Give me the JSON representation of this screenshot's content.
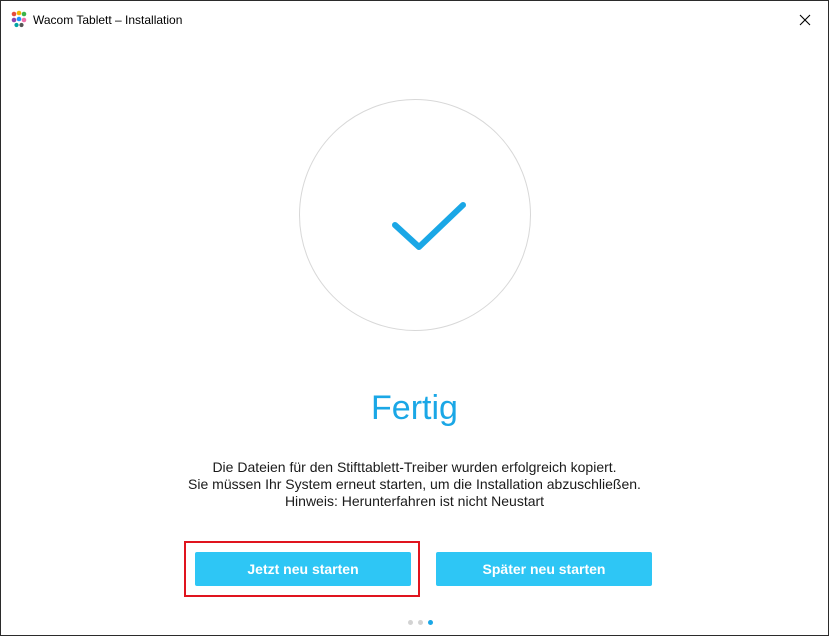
{
  "window": {
    "title": "Wacom Tablett – Installation",
    "app_icon": "wacom-logo-icon",
    "close_icon": "close-icon"
  },
  "status": {
    "icon": "checkmark-icon",
    "heading": "Fertig",
    "message_lines": [
      "Die Dateien für den Stifttablett-Treiber wurden erfolgreich kopiert.",
      "Sie müssen Ihr System erneut starten, um die Installation abzuschließen.",
      "Hinweis: Herunterfahren ist nicht Neustart"
    ]
  },
  "buttons": {
    "restart_now": "Jetzt neu starten",
    "restart_later": "Später neu starten"
  },
  "pager": {
    "total": 3,
    "current": 3
  },
  "colors": {
    "accent": "#1aa7e6",
    "button": "#2ec6f5",
    "highlight": "#e0141e"
  }
}
